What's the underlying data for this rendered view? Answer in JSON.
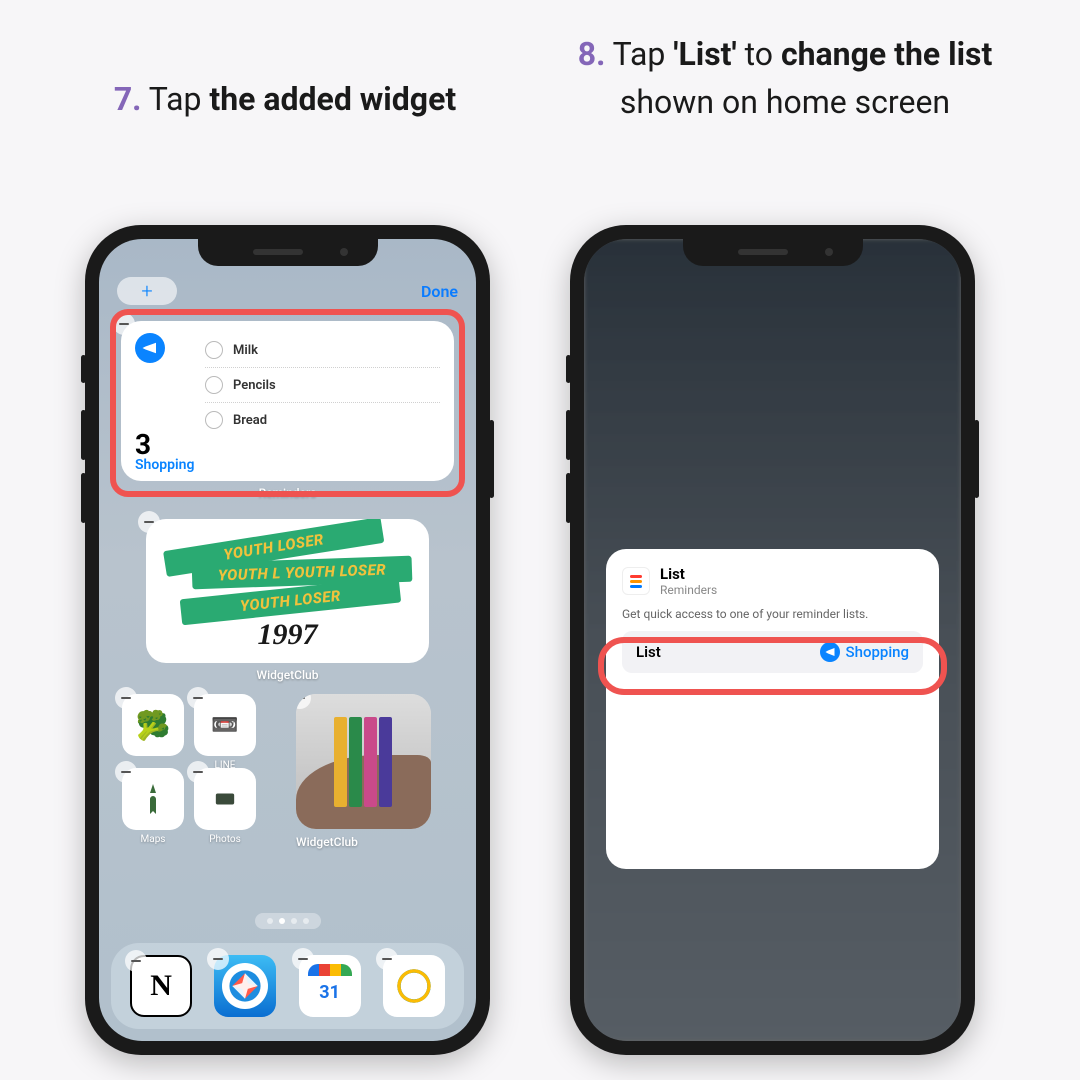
{
  "steps": {
    "left": {
      "number": "7.",
      "prefix": "Tap ",
      "bold": "the added widget"
    },
    "right": {
      "number": "8.",
      "prefix": "Tap ",
      "bold1": "'List'",
      "mid": " to ",
      "bold2": "change the list",
      "suffix": " shown on home screen"
    }
  },
  "topbar": {
    "add": "+",
    "done": "Done"
  },
  "reminders_widget": {
    "count": "3",
    "list_name": "Shopping",
    "caption": "Reminders",
    "items": [
      "Milk",
      "Pencils",
      "Bread"
    ]
  },
  "photo_widget": {
    "tag1": "YOUTH LOSER",
    "tag2": "YOUTH L  YOUTH LOSER",
    "tag3": "YOUTH LOSER",
    "year": "1997",
    "caption": "WidgetClub"
  },
  "apps": {
    "broccoli": "",
    "line": "LINE",
    "maps": "Maps",
    "photos": "Photos",
    "widgetclub": "WidgetClub"
  },
  "dock": {
    "notion": "N",
    "calendar_day": "31"
  },
  "config_card": {
    "title": "List",
    "subtitle": "Reminders",
    "description": "Get quick access to one of your reminder lists.",
    "row_label": "List",
    "row_value": "Shopping"
  }
}
